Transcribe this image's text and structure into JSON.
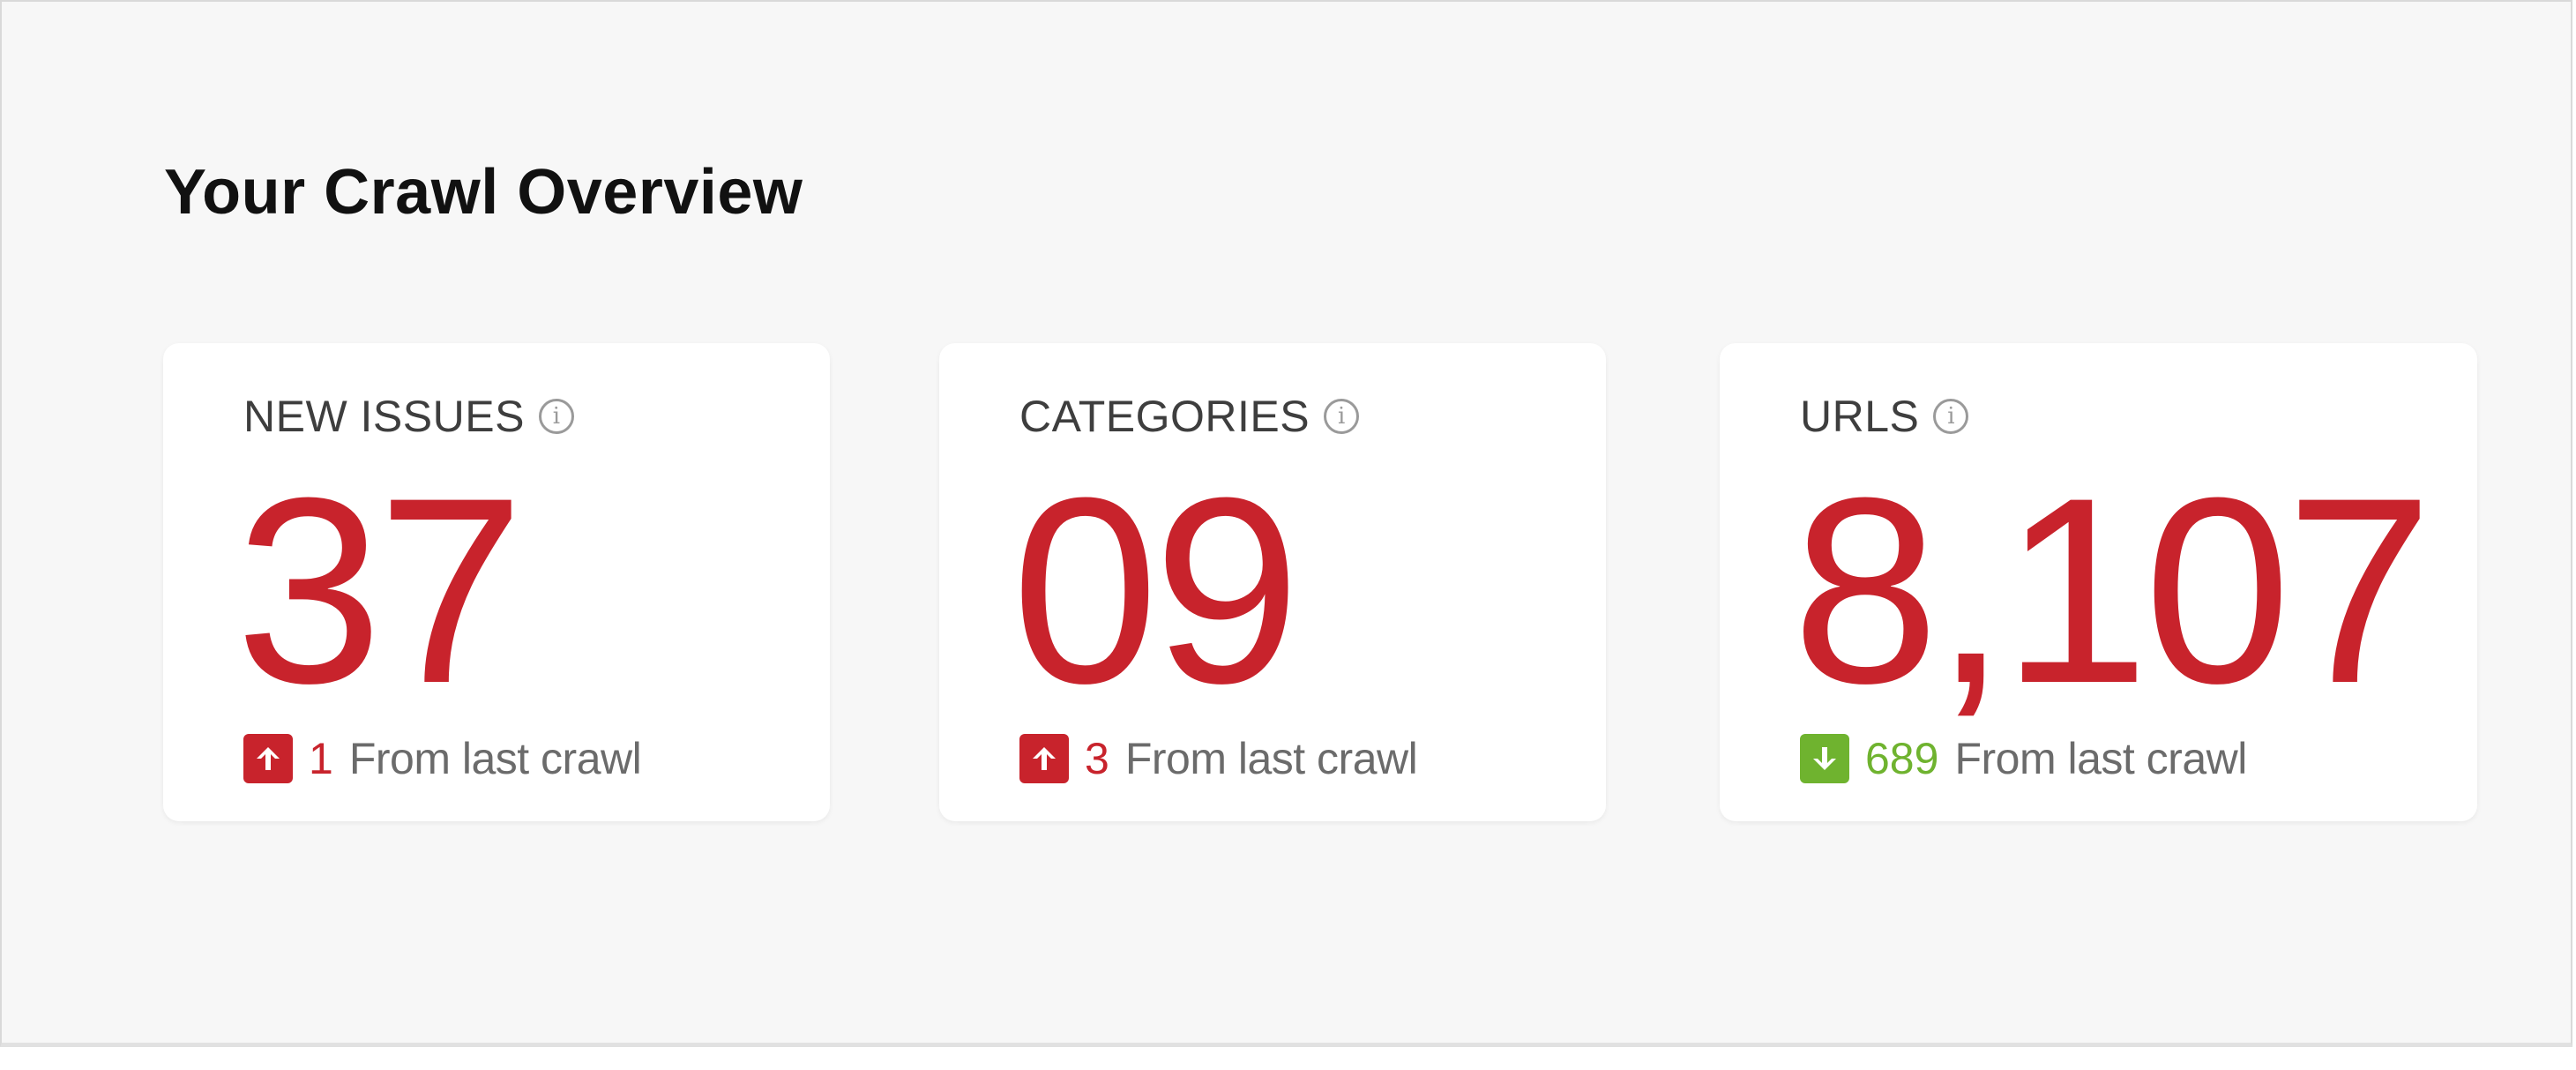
{
  "page": {
    "title": "Your Crawl Overview"
  },
  "cards": [
    {
      "label": "NEW ISSUES",
      "value": "37",
      "delta": "1",
      "delta_direction": "up",
      "delta_text": "From last crawl",
      "delta_color": "#c8232c"
    },
    {
      "label": "CATEGORIES",
      "value": "09",
      "delta": "3",
      "delta_direction": "up",
      "delta_text": "From last crawl",
      "delta_color": "#c8232c"
    },
    {
      "label": "URLS",
      "value": "8,107",
      "delta": "689",
      "delta_direction": "down",
      "delta_text": "From last crawl",
      "delta_color": "#6fb32f"
    }
  ],
  "icons": {
    "info": "info-icon",
    "up": "arrow-up-icon",
    "down": "arrow-down-icon"
  },
  "colors": {
    "accent_red": "#c8232c",
    "accent_green": "#6fb32f",
    "background": "#f7f7f7"
  }
}
